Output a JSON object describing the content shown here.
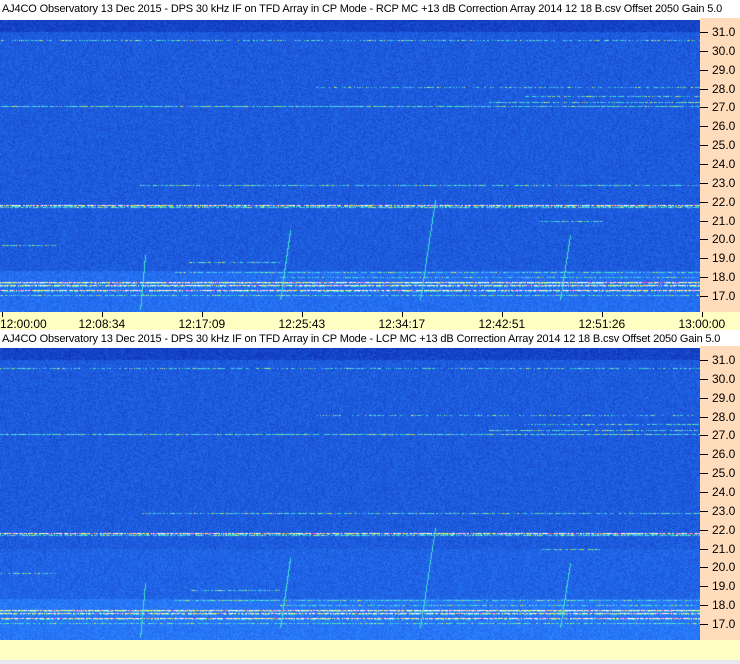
{
  "chart_data": [
    {
      "type": "heatmap",
      "title": "AJ4CO Observatory 13 Dec 2015 - DPS 30 kHz IF on TFD Array in CP Mode - RCP  MC +13 dB  Correction Array 2014 12 18 B.csv  Offset 2050  Gain 5.0",
      "polarization": "RCP",
      "y_ticks": [
        "31.0",
        "30.0",
        "29.0",
        "28.0",
        "27.0",
        "26.0",
        "25.0",
        "24.0",
        "23.0",
        "22.0",
        "21.0",
        "20.0",
        "19.0",
        "18.0",
        "17.0"
      ],
      "x_ticks": [
        "12:00:00",
        "12:08:34",
        "12:17:09",
        "12:25:43",
        "12:34:17",
        "12:42:51",
        "12:51:26",
        "13:00:00"
      ],
      "ylim": [
        16.6,
        31.6
      ],
      "xlim": [
        "12:00:00",
        "13:00:00"
      ],
      "colormap": [
        "#0a1e8c",
        "#1e50dc",
        "#3aa0f0",
        "#40e0d0",
        "#f0f040",
        "#ff40c0",
        "#ffffff"
      ]
    },
    {
      "type": "heatmap",
      "title": "AJ4CO Observatory 13 Dec 2015 - DPS 30 kHz IF on TFD Array in CP Mode - LCP  MC +13 dB  Correction Array 2014 12 18 B.csv  Offset 2050  Gain 5.0",
      "polarization": "LCP",
      "y_ticks": [
        "31.0",
        "30.0",
        "29.0",
        "28.0",
        "27.0",
        "26.0",
        "25.0",
        "24.0",
        "23.0",
        "22.0",
        "21.0",
        "20.0",
        "19.0",
        "18.0",
        "17.0"
      ],
      "x_ticks": [],
      "ylim": [
        16.6,
        31.6
      ],
      "xlim": [
        "12:00:00",
        "13:00:00"
      ],
      "colormap": [
        "#0a1e8c",
        "#1e50dc",
        "#3aa0f0",
        "#40e0d0",
        "#f0f040",
        "#ff40c0",
        "#ffffff"
      ]
    }
  ],
  "colors": {
    "axis_bg": "#fedcbc",
    "time_bar_bg": "#ffffc4"
  }
}
